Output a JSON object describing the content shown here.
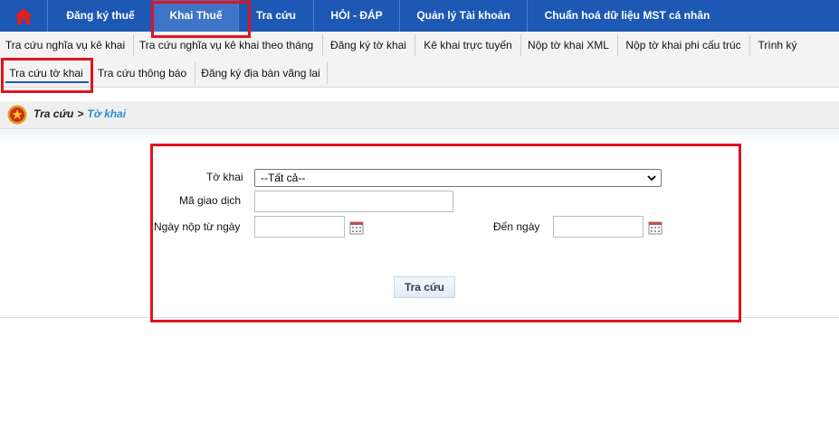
{
  "topnav": {
    "home_icon": "home-icon",
    "items": [
      {
        "label": "Đăng ký thuế"
      },
      {
        "label": "Khai Thuế"
      },
      {
        "label": "Tra cứu"
      },
      {
        "label": "HỎI - ĐÁP"
      },
      {
        "label": "Quản lý Tài khoản"
      },
      {
        "label": "Chuẩn hoá dữ liệu MST cá nhân"
      }
    ],
    "active_index": 1
  },
  "subnav": {
    "items": [
      {
        "label": "Tra cứu nghĩa vụ kê khai"
      },
      {
        "label": "Tra cứu nghĩa vụ kê khai theo tháng"
      },
      {
        "label": "Đăng ký tờ khai"
      },
      {
        "label": "Kê khai trực tuyến"
      },
      {
        "label": "Nộp tờ khai XML"
      },
      {
        "label": "Nộp tờ khai phi cấu trúc"
      },
      {
        "label": "Trình ký"
      },
      {
        "label": "Tra cứu tờ khai"
      },
      {
        "label": "Tra cứu thông báo"
      },
      {
        "label": "Đăng ký địa bàn vãng lai"
      }
    ],
    "active_index": 7
  },
  "breadcrumb": {
    "root": "Tra cứu",
    "separator": ">",
    "current": "Tờ khai"
  },
  "form": {
    "to_khai_label": "Tờ khai",
    "to_khai_value": "--Tất cả--",
    "ma_giao_dich_label": "Mã giao dịch",
    "ma_giao_dich_value": "",
    "ngay_nop_tu_label": "Ngày nộp từ ngày",
    "ngay_nop_tu_value": "",
    "den_ngay_label": "Đến ngày",
    "den_ngay_value": "",
    "submit_label": "Tra cứu"
  },
  "colors": {
    "nav_bg": "#1d58b4",
    "nav_active": "#3f74c6",
    "highlight": "#e0141e",
    "breadcrumb_current": "#2a8fd0"
  }
}
